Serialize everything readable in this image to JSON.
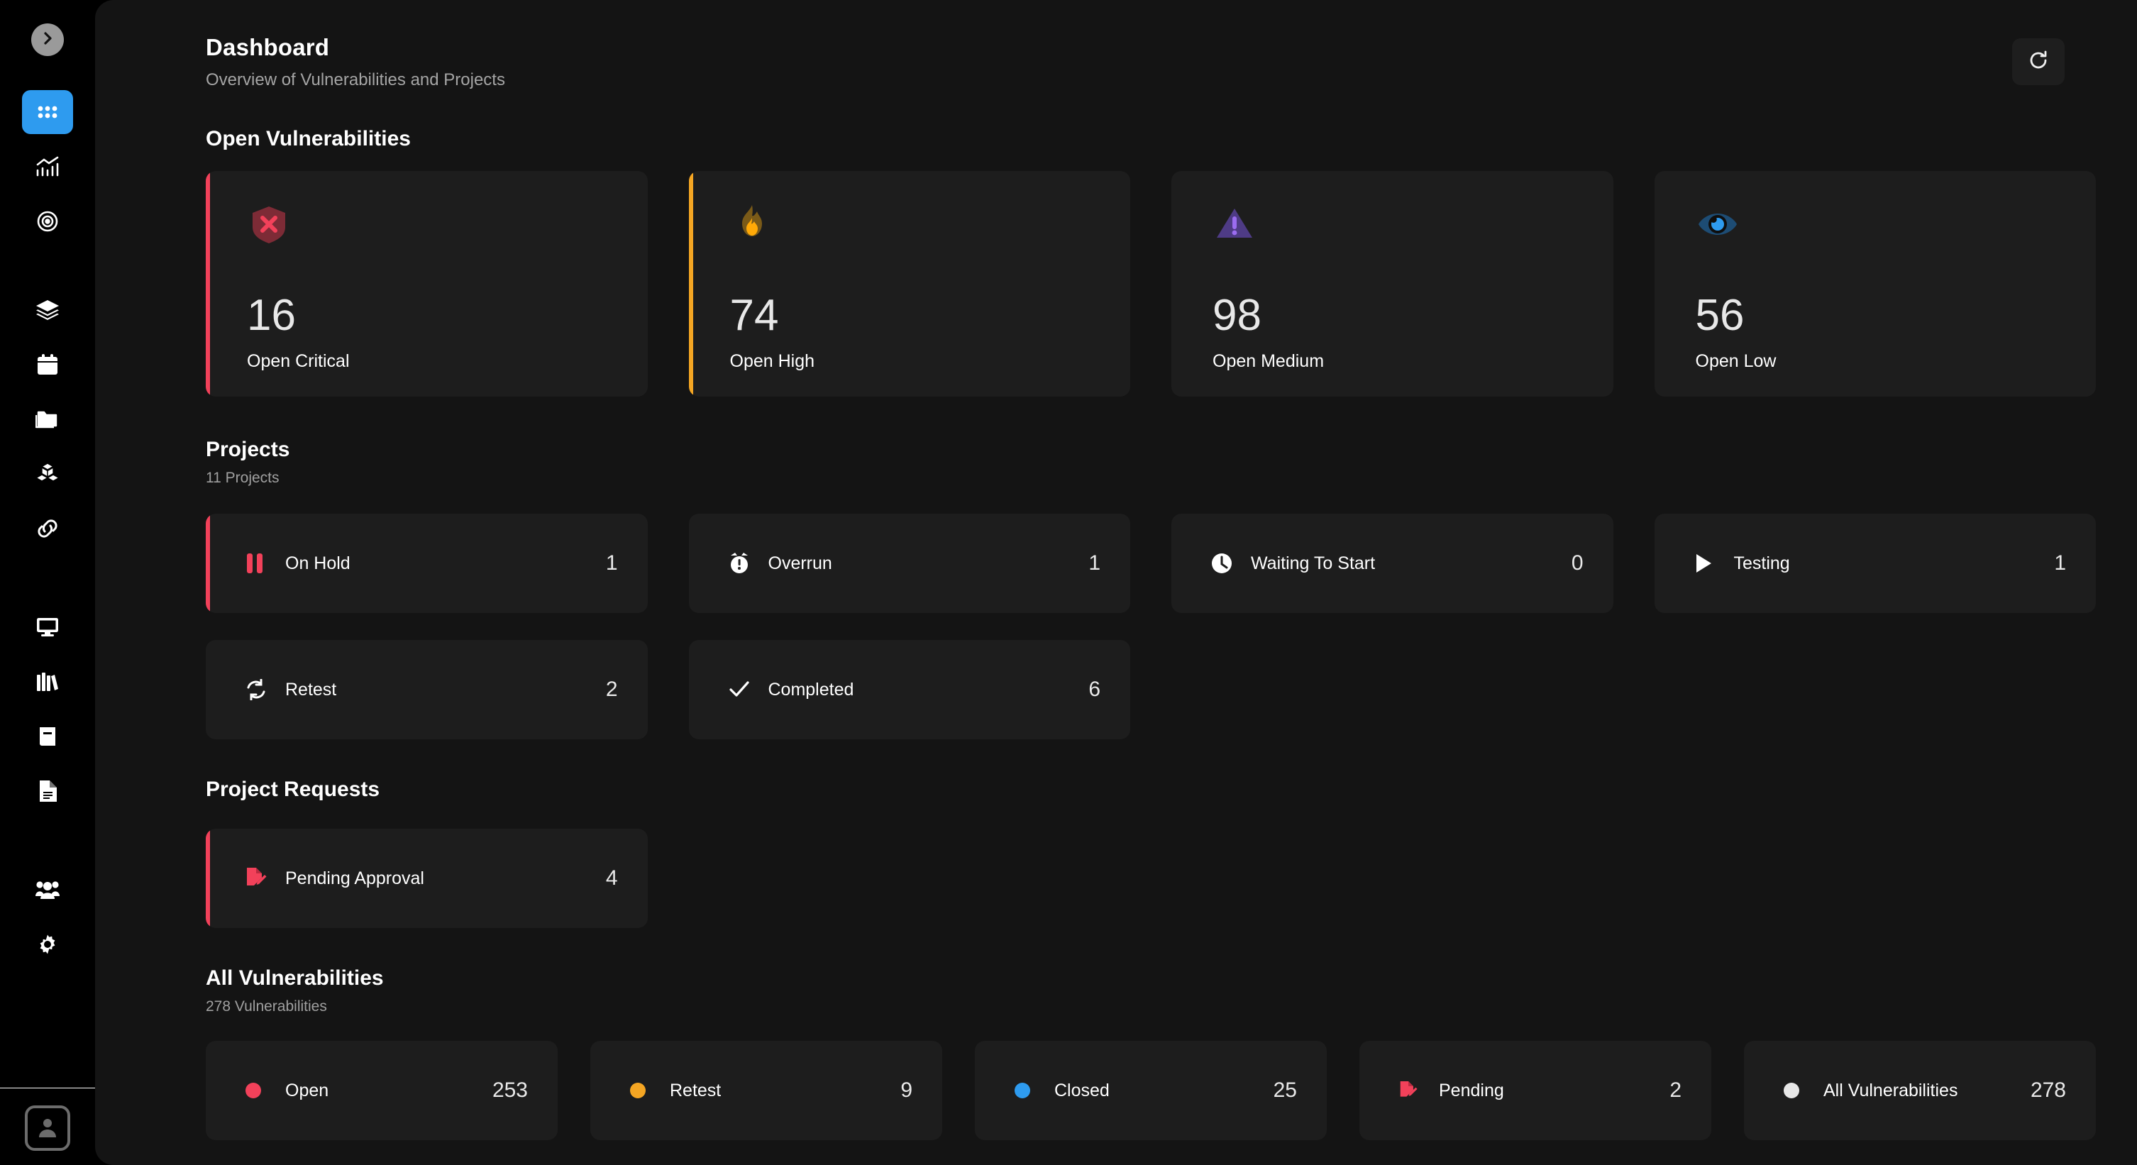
{
  "sidebar": {
    "collapse_icon": "chevron-right-circle-icon",
    "items": [
      {
        "icon": "dashboard-grid-icon",
        "name": "dashboard",
        "active": true
      },
      {
        "icon": "analytics-chart-icon",
        "name": "analytics",
        "active": false
      },
      {
        "icon": "target-icon",
        "name": "targets",
        "active": false
      },
      {
        "icon": "layers-icon",
        "name": "layers",
        "active": false
      },
      {
        "icon": "calendar-icon",
        "name": "calendar",
        "active": false
      },
      {
        "icon": "folder-icon",
        "name": "projects",
        "active": false
      },
      {
        "icon": "cubes-icon",
        "name": "assets",
        "active": false
      },
      {
        "icon": "link-icon",
        "name": "integrations",
        "active": false
      },
      {
        "icon": "monitor-icon",
        "name": "monitoring",
        "active": false
      },
      {
        "icon": "books-icon",
        "name": "library",
        "active": false
      },
      {
        "icon": "book-icon",
        "name": "knowledge-base",
        "active": false
      },
      {
        "icon": "document-icon",
        "name": "reports",
        "active": false
      },
      {
        "icon": "people-icon",
        "name": "users",
        "active": false
      },
      {
        "icon": "gear-icon",
        "name": "settings",
        "active": false
      }
    ],
    "avatar_icon": "user-avatar-icon"
  },
  "header": {
    "title": "Dashboard",
    "subtitle": "Overview of Vulnerabilities and Projects",
    "refresh_icon": "refresh-icon"
  },
  "open_vulnerabilities": {
    "heading": "Open Vulnerabilities",
    "cards": [
      {
        "value": "16",
        "label": "Open Critical",
        "icon": "shield-x-icon",
        "accent": "#f2415a",
        "edge": true
      },
      {
        "value": "74",
        "label": "Open High",
        "icon": "flame-icon",
        "accent": "#f5a623",
        "edge": true
      },
      {
        "value": "98",
        "label": "Open Medium",
        "icon": "warning-triangle-icon",
        "accent": "#7e4fd6",
        "edge": false
      },
      {
        "value": "56",
        "label": "Open Low",
        "icon": "eye-icon",
        "accent": "#2e9bef",
        "edge": false
      }
    ]
  },
  "projects": {
    "heading": "Projects",
    "count_label": "11 Projects",
    "cards": [
      {
        "label": "On Hold",
        "value": "1",
        "icon": "pause-icon",
        "accent": "#f2415a",
        "edge": true
      },
      {
        "label": "Overrun",
        "value": "1",
        "icon": "alarm-clock-icon",
        "accent": "#ffffff",
        "edge": false
      },
      {
        "label": "Waiting To Start",
        "value": "0",
        "icon": "clock-icon",
        "accent": "#ffffff",
        "edge": false
      },
      {
        "label": "Testing",
        "value": "1",
        "icon": "play-icon",
        "accent": "#ffffff",
        "edge": false
      },
      {
        "label": "Retest",
        "value": "2",
        "icon": "refresh-cycle-icon",
        "accent": "#ffffff",
        "edge": false
      },
      {
        "label": "Completed",
        "value": "6",
        "icon": "check-icon",
        "accent": "#ffffff",
        "edge": false
      }
    ]
  },
  "project_requests": {
    "heading": "Project Requests",
    "cards": [
      {
        "label": "Pending Approval",
        "value": "4",
        "icon": "document-edit-icon",
        "accent": "#f2415a",
        "edge": true
      }
    ]
  },
  "all_vulnerabilities": {
    "heading": "All Vulnerabilities",
    "count_label": "278 Vulnerabilities",
    "cards": [
      {
        "label": "Open",
        "value": "253",
        "icon": "dot-icon",
        "accent": "#f2415a"
      },
      {
        "label": "Retest",
        "value": "9",
        "icon": "dot-icon",
        "accent": "#f5a623"
      },
      {
        "label": "Closed",
        "value": "25",
        "icon": "dot-icon",
        "accent": "#2e9bef"
      },
      {
        "label": "Pending",
        "value": "2",
        "icon": "document-edit-icon",
        "accent": "#f2415a"
      },
      {
        "label": "All Vulnerabilities",
        "value": "278",
        "icon": "dot-icon",
        "accent": "#e8e8e8"
      }
    ]
  }
}
